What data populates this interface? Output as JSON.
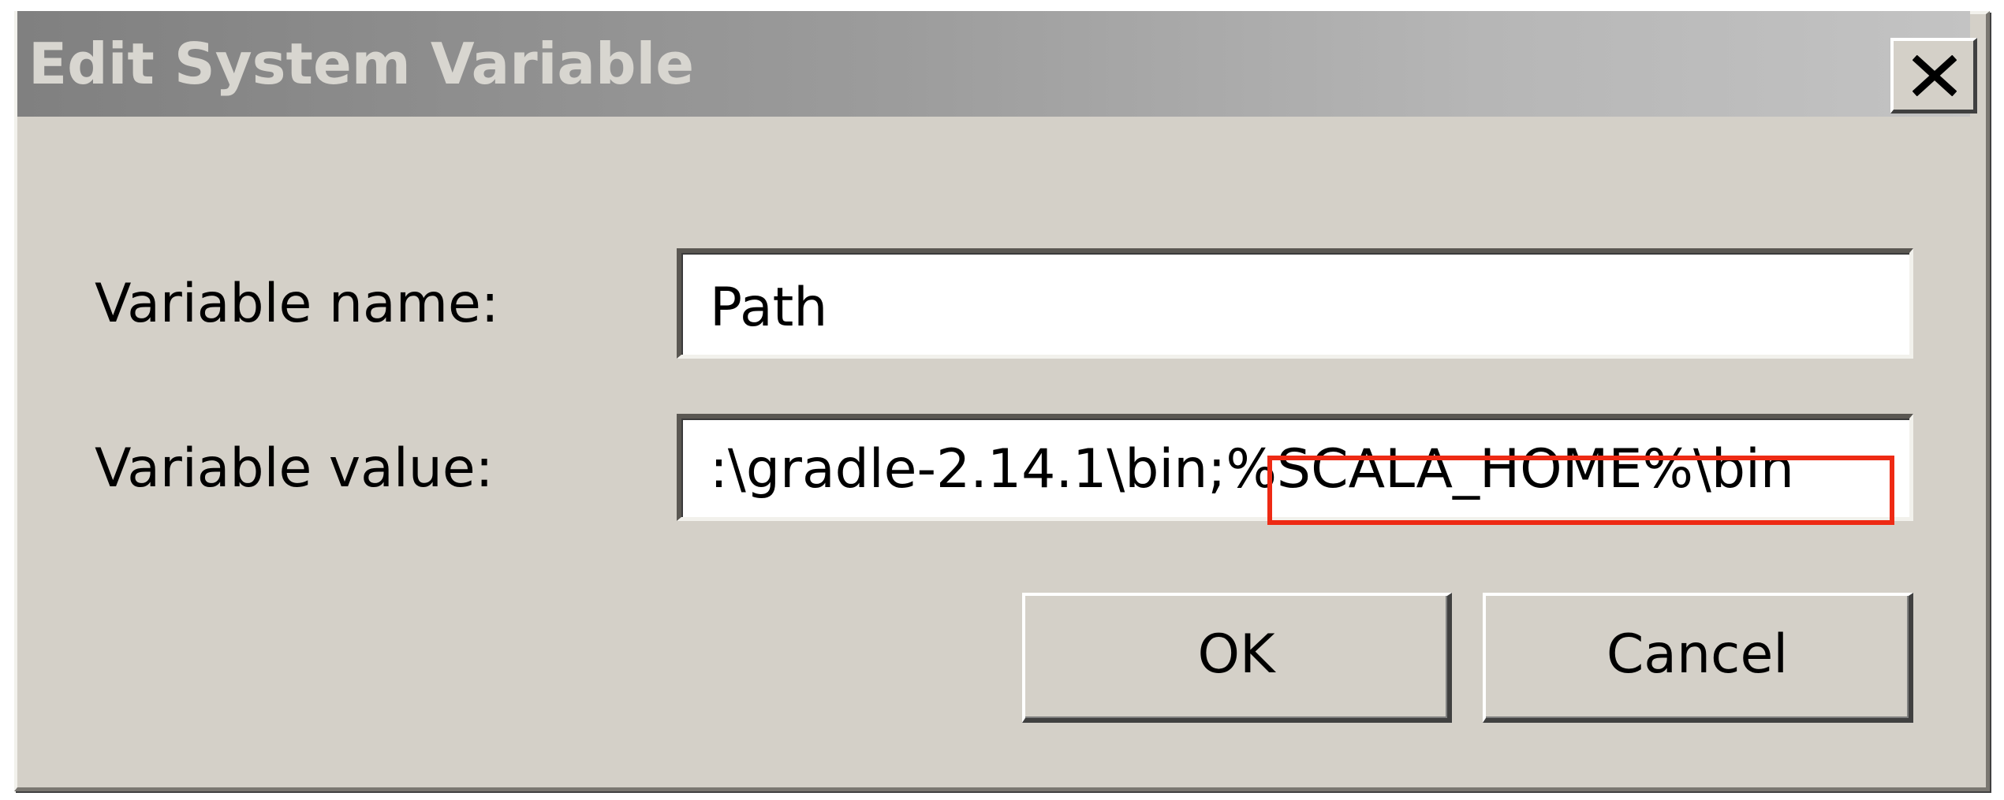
{
  "window": {
    "title": "Edit System Variable",
    "close_icon": "close-icon"
  },
  "form": {
    "name_label": "Variable name:",
    "name_value": "Path",
    "value_label": "Variable value:",
    "value_text_prefix": ":\\gradle-2.14.1\\bin;",
    "value_text_highlighted": "%SCALA_HOME%\\bin"
  },
  "buttons": {
    "ok_label": "OK",
    "cancel_label": "Cancel"
  },
  "colors": {
    "dialog_background": "#d4d0c8",
    "titlebar_inactive": "#808080",
    "highlight_border": "#ee2a14"
  }
}
